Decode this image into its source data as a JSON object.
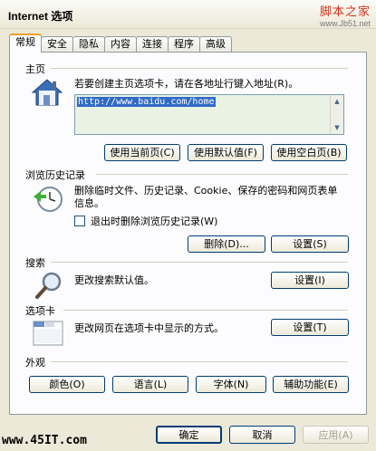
{
  "window": {
    "title": "Internet 选项",
    "watermark_top_main": "脚本之家",
    "watermark_top_url": "www.Jb51.net",
    "watermark_bottom": "www.45IT.com"
  },
  "tabs": [
    {
      "label": "常规",
      "active": true
    },
    {
      "label": "安全"
    },
    {
      "label": "隐私"
    },
    {
      "label": "内容"
    },
    {
      "label": "连接"
    },
    {
      "label": "程序"
    },
    {
      "label": "高级"
    }
  ],
  "home": {
    "title": "主页",
    "description": "若要创建主页选项卡，请在各地址行键入地址(R)。",
    "url": "http://www.baidu.com/home",
    "use_current": "使用当前页(C)",
    "use_default": "使用默认值(F)",
    "use_blank": "使用空白页(B)"
  },
  "history": {
    "title": "浏览历史记录",
    "description": "删除临时文件、历史记录、Cookie、保存的密码和网页表单信息。",
    "checkbox_label": "退出时删除浏览历史记录(W)",
    "delete_button": "删除(D)...",
    "settings_button": "设置(S)"
  },
  "search": {
    "title": "搜索",
    "description": "更改搜索默认值。",
    "settings_button": "设置(I)"
  },
  "tabs_section": {
    "title": "选项卡",
    "description": "更改网页在选项卡中显示的方式。",
    "settings_button": "设置(T)"
  },
  "appearance": {
    "title": "外观",
    "colors": "颜色(O)",
    "languages": "语言(L)",
    "fonts": "字体(N)",
    "accessibility": "辅助功能(E)"
  },
  "footer": {
    "ok": "确定",
    "cancel": "取消",
    "apply": "应用(A)"
  }
}
